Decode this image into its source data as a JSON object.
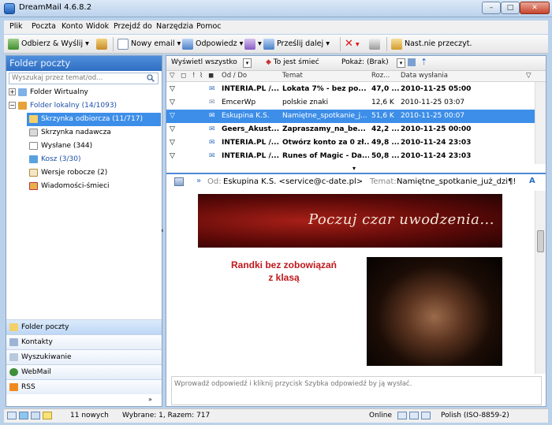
{
  "window": {
    "title": "DreamMail 4.6.8.2",
    "minimize": "–",
    "maximize": "□",
    "close": "✕"
  },
  "menu": [
    "Plik",
    "Poczta",
    "Konto",
    "Widok",
    "Przejdź do",
    "Narzędzia",
    "Pomoc"
  ],
  "toolbar": {
    "send_receive": "Odbierz & Wyślij",
    "new_email": "Nowy email",
    "reply": "Odpowiedz",
    "forward": "Prześlij dalej",
    "next_unread": "Nast.nie przeczyt."
  },
  "left_pane": {
    "title": "Folder poczty",
    "search_placeholder": "Wyszukaj przez temat/od...",
    "tree": [
      {
        "label": "Folder Wirtualny",
        "expander": "+"
      },
      {
        "label": "Folder lokalny (14/1093)",
        "expander": "−"
      },
      {
        "label": "Skrzynka odbiorcza (11/717)"
      },
      {
        "label": "Skrzynka nadawcza"
      },
      {
        "label": "Wysłane (344)"
      },
      {
        "label": "Kosz (3/30)"
      },
      {
        "label": "Wersje robocze (2)"
      },
      {
        "label": "Wiadomości-śmieci"
      }
    ],
    "nav": [
      "Folder poczty",
      "Kontakty",
      "Wyszukiwanie",
      "WebMail",
      "RSS"
    ]
  },
  "filterbar": {
    "view": "Wyświetl wszystko",
    "spam": "To jest śmieć",
    "show_label": "Pokaż:",
    "show_value": "(Brak)"
  },
  "columns": {
    "from": "Od / Do",
    "subject": "Temat",
    "size": "Roz...",
    "date": "Data wysłania"
  },
  "messages": [
    {
      "from": "INTERIA.PL /...",
      "subject": "Lokata 7% - bez po...",
      "size": "47,0 ...",
      "date": "2010-11-25 05:00",
      "unread": true
    },
    {
      "from": "EmcerWp",
      "subject": "polskie znaki",
      "size": "12,6 K",
      "date": "2010-11-25 03:07",
      "unread": false
    },
    {
      "from": "Eskupina K.S.",
      "subject": "Namiętne_spotkanie_j...",
      "size": "51,6 K",
      "date": "2010-11-25 00:07",
      "unread": false
    },
    {
      "from": "Geers_Akust...",
      "subject": "Zapraszamy_na_be...",
      "size": "42,2 ...",
      "date": "2010-11-25 00:00",
      "unread": true
    },
    {
      "from": "INTERIA.PL /...",
      "subject": "Otwórz konto za 0 zł...",
      "size": "49,8 ...",
      "date": "2010-11-24 23:03",
      "unread": true
    },
    {
      "from": "INTERIA.PL /...",
      "subject": "Runes of Magic - Da...",
      "size": "50,8 ...",
      "date": "2010-11-24 23:03",
      "unread": true
    }
  ],
  "preview": {
    "from_label": "Od:",
    "from_value": "Eskupina K.S. <service@c-date.pl>",
    "subject_label": "Temat:",
    "subject_value": "Namiętne_spotkanie_już_dzi¶!",
    "banner_text": "Poczuj czar uwodzenia...",
    "promo_line1": "Randki bez zobowiązań",
    "promo_line2": "z klasą",
    "reply_placeholder": "Wprowadź odpowiedź i kliknij przycisk Szybka odpowiedź by ją wysłać."
  },
  "status": {
    "new_count": "11 nowych",
    "selection": "Wybrane: 1, Razem: 717",
    "online": "Online",
    "encoding": "Polish (ISO-8859-2)"
  },
  "colors": {
    "selection": "#3d8ee8",
    "header": "#2f6ec2",
    "promo_red": "#c0171c"
  }
}
